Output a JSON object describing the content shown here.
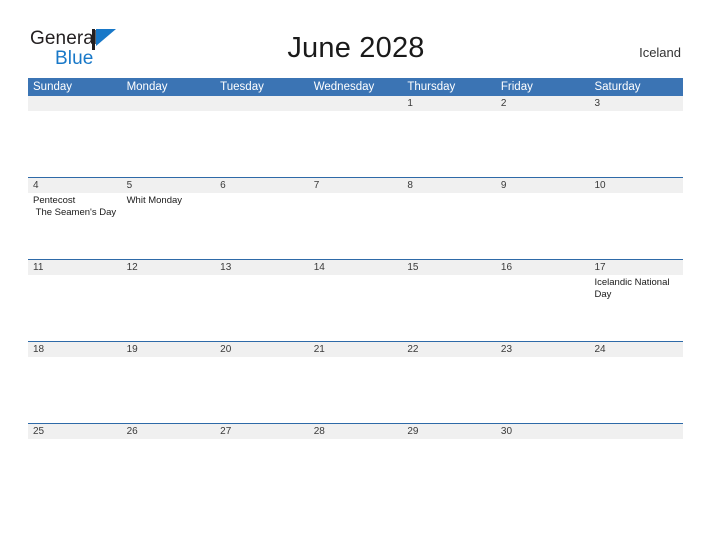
{
  "brand": {
    "name_part1": "General",
    "name_part2": "Blue",
    "flag_icon": "blue-triangle-flag-icon",
    "accent_color": "#1878c8"
  },
  "header": {
    "title": "June 2028",
    "country": "Iceland"
  },
  "theme": {
    "header_blue": "#3b74b4",
    "row_rule_blue": "#2e6aa8",
    "date_band_gray": "#f0f0f0",
    "text_dark": "#1a1a1a"
  },
  "calendar": {
    "day_headers": [
      "Sunday",
      "Monday",
      "Tuesday",
      "Wednesday",
      "Thursday",
      "Friday",
      "Saturday"
    ],
    "weeks": [
      {
        "days": [
          {
            "num": "",
            "events": []
          },
          {
            "num": "",
            "events": []
          },
          {
            "num": "",
            "events": []
          },
          {
            "num": "",
            "events": []
          },
          {
            "num": "1",
            "events": []
          },
          {
            "num": "2",
            "events": []
          },
          {
            "num": "3",
            "events": []
          }
        ]
      },
      {
        "days": [
          {
            "num": "4",
            "events": [
              "Pentecost",
              " The Seamen's Day"
            ]
          },
          {
            "num": "5",
            "events": [
              "Whit Monday"
            ]
          },
          {
            "num": "6",
            "events": []
          },
          {
            "num": "7",
            "events": []
          },
          {
            "num": "8",
            "events": []
          },
          {
            "num": "9",
            "events": []
          },
          {
            "num": "10",
            "events": []
          }
        ]
      },
      {
        "days": [
          {
            "num": "11",
            "events": []
          },
          {
            "num": "12",
            "events": []
          },
          {
            "num": "13",
            "events": []
          },
          {
            "num": "14",
            "events": []
          },
          {
            "num": "15",
            "events": []
          },
          {
            "num": "16",
            "events": []
          },
          {
            "num": "17",
            "events": [
              "Icelandic National Day"
            ]
          }
        ]
      },
      {
        "days": [
          {
            "num": "18",
            "events": []
          },
          {
            "num": "19",
            "events": []
          },
          {
            "num": "20",
            "events": []
          },
          {
            "num": "21",
            "events": []
          },
          {
            "num": "22",
            "events": []
          },
          {
            "num": "23",
            "events": []
          },
          {
            "num": "24",
            "events": []
          }
        ]
      },
      {
        "days": [
          {
            "num": "25",
            "events": []
          },
          {
            "num": "26",
            "events": []
          },
          {
            "num": "27",
            "events": []
          },
          {
            "num": "28",
            "events": []
          },
          {
            "num": "29",
            "events": []
          },
          {
            "num": "30",
            "events": []
          },
          {
            "num": "",
            "events": []
          }
        ]
      }
    ]
  }
}
